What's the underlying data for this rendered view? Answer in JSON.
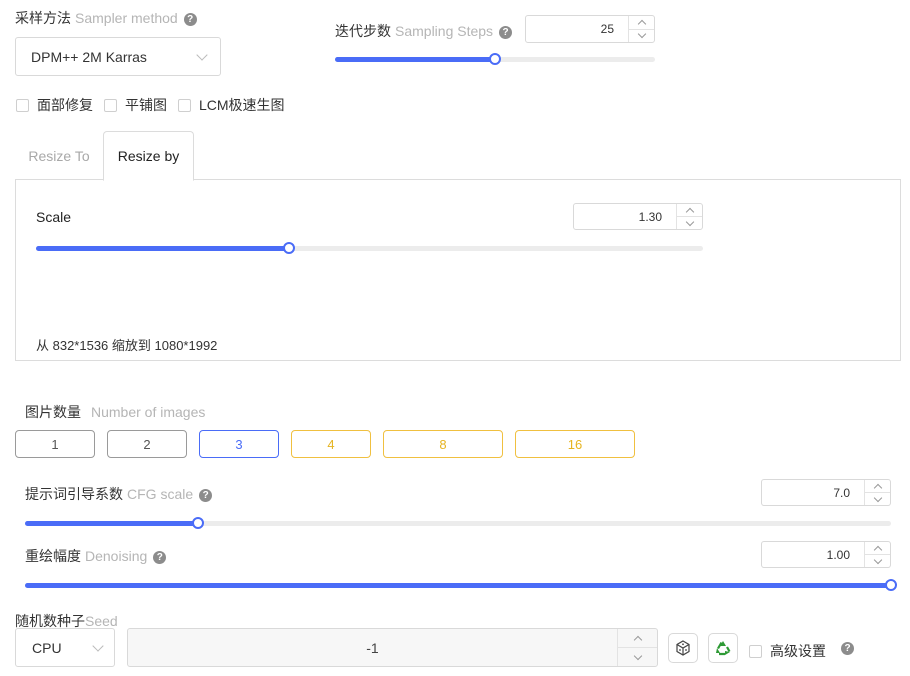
{
  "sampler": {
    "label_cn": "采样方法",
    "label_en": "Sampler method",
    "help_icon": "question-circle-icon",
    "value": "DPM++ 2M Karras"
  },
  "steps": {
    "label_cn": "迭代步数",
    "label_en": "Sampling Steps",
    "help_icon": "question-circle-icon",
    "value": "25",
    "fraction": 0.5
  },
  "checkboxes": [
    {
      "label": "面部修复",
      "checked": false
    },
    {
      "label": "平铺图",
      "checked": false
    },
    {
      "label": "LCM极速生图",
      "checked": false
    }
  ],
  "tabs": [
    {
      "label": "Resize To",
      "active": false
    },
    {
      "label": "Resize by",
      "active": true
    }
  ],
  "scale": {
    "label": "Scale",
    "value": "1.30",
    "fraction": 0.38,
    "info": "从 832*1536 缩放到 1080*1992"
  },
  "images": {
    "label_cn": "图片数量",
    "label_en": "Number of images",
    "options": [
      "1",
      "2",
      "3",
      "4",
      "8",
      "16"
    ],
    "selected": "3",
    "colors": {
      "default": "#9a9a9a",
      "selected": "#4a6cf7",
      "premium": "#f0c040"
    }
  },
  "cfg": {
    "label_cn": "提示词引导系数",
    "label_en": "CFG scale",
    "help_icon": "question-circle-icon",
    "value": "7.0",
    "fraction": 0.2
  },
  "denoise": {
    "label_cn": "重绘幅度",
    "label_en": "Denoising",
    "help_icon": "question-circle-icon",
    "value": "1.00",
    "fraction": 1.0
  },
  "seed": {
    "label_cn": "随机数种子",
    "label_en": "Seed",
    "device": "CPU",
    "value": "-1",
    "dice_icon": "dice-icon",
    "recycle_icon": "recycle-icon",
    "advanced_label": "高级设置",
    "advanced_checked": false
  },
  "colors": {
    "accent": "#4a6cf7",
    "border": "#d9d9d9",
    "muted": "#b5b5b5"
  }
}
